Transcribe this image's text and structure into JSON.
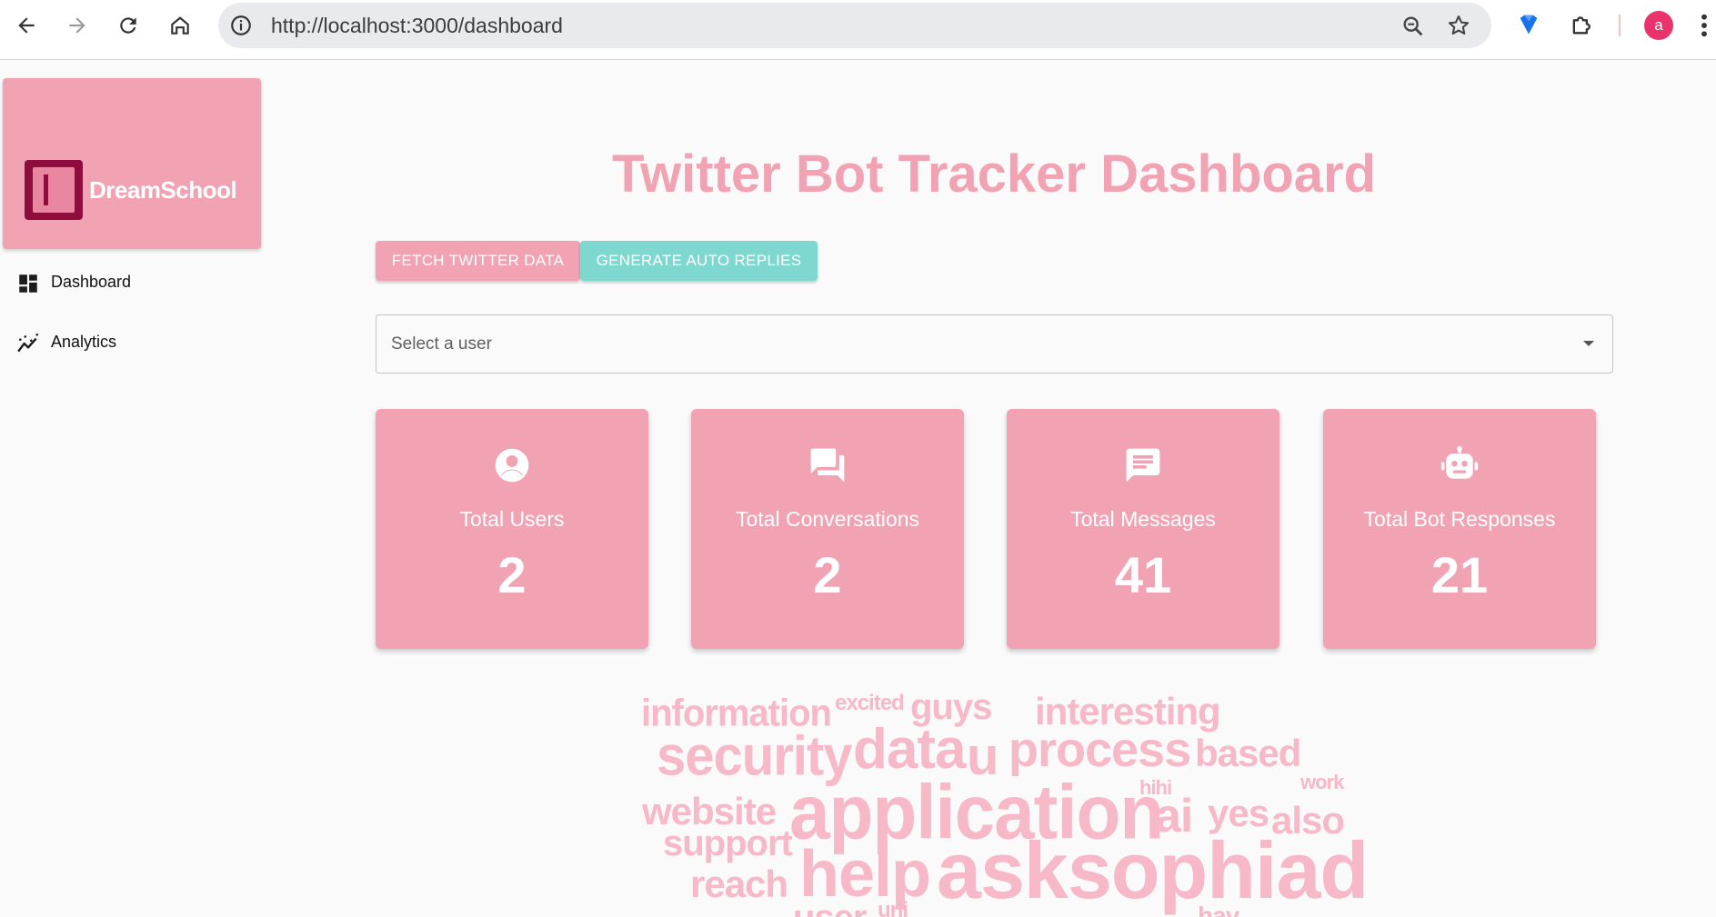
{
  "browser": {
    "url": "http://localhost:3000/dashboard",
    "avatar_letter": "a"
  },
  "sidebar": {
    "logo_text": "DreamSchool",
    "items": [
      {
        "label": "Dashboard",
        "icon": "dashboard-icon"
      },
      {
        "label": "Analytics",
        "icon": "analytics-icon"
      }
    ]
  },
  "main": {
    "title": "Twitter Bot Tracker Dashboard",
    "fetch_button": "FETCH TWITTER DATA",
    "generate_button": "GENERATE AUTO REPLIES",
    "user_select_placeholder": "Select a user",
    "stats": [
      {
        "label": "Total Users",
        "value": "2",
        "icon": "account-circle-icon"
      },
      {
        "label": "Total Conversations",
        "value": "2",
        "icon": "forum-icon"
      },
      {
        "label": "Total Messages",
        "value": "41",
        "icon": "chat-icon"
      },
      {
        "label": "Total Bot Responses",
        "value": "21",
        "icon": "robot-icon"
      }
    ]
  },
  "word_cloud": [
    "information",
    "excited",
    "guys",
    "interesting",
    "security",
    "data",
    "u",
    "process",
    "based",
    "website",
    "application",
    "hihi",
    "ai",
    "yes",
    "also",
    "work",
    "support",
    "reach",
    "help",
    "asksophiads",
    "user",
    "uni",
    "hay"
  ],
  "colors": {
    "primary_pink": "#f2a3b3",
    "teal": "#7fd8d0",
    "cloud_pink": "#f7b8c8",
    "logo_dark": "#8e0d3d",
    "background": "#fafafa"
  }
}
